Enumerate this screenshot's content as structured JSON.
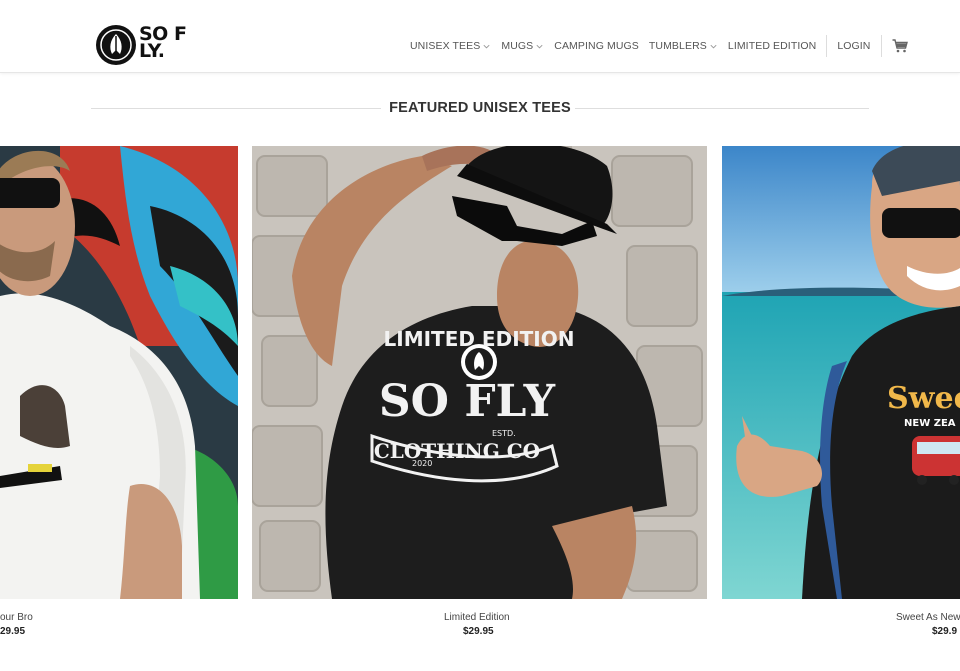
{
  "brand": {
    "logo_text": "SO FLY."
  },
  "nav": {
    "items": [
      {
        "label": "UNISEX TEES",
        "has_dropdown": true
      },
      {
        "label": "MUGS",
        "has_dropdown": true
      },
      {
        "label": "CAMPING MUGS",
        "has_dropdown": false
      },
      {
        "label": "TUMBLERS",
        "has_dropdown": true
      },
      {
        "label": "LIMITED EDITION",
        "has_dropdown": false
      }
    ],
    "login_label": "LOGIN",
    "cart_icon": "cart-icon"
  },
  "section": {
    "title": "FEATURED UNISEX TEES"
  },
  "products": [
    {
      "name": "our Bro",
      "price": "29.95"
    },
    {
      "name": "Limited Edition",
      "price": "$29.95",
      "shirt_text": {
        "top": "LIMITED EDITION",
        "main": "SO FLY",
        "sub": "CLOTHING CO",
        "year": "2020",
        "estd": "ESTD."
      }
    },
    {
      "name": "Sweet As New",
      "price": "$29.9",
      "shirt_text": {
        "main": "Sweet",
        "sub": "NEW ZEA"
      }
    }
  ],
  "colors": {
    "text": "#333333",
    "divider": "#dedede",
    "accent": "#111111"
  }
}
